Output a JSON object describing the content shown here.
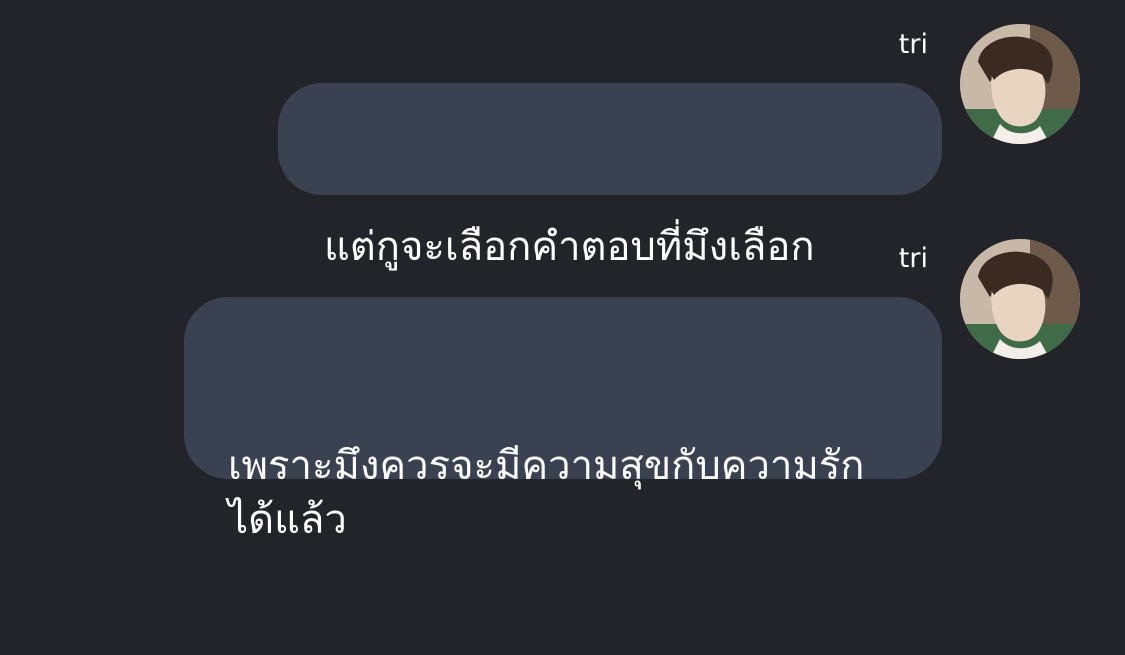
{
  "colors": {
    "background": "#23242a",
    "bubble": "#3a4151",
    "text": "#ffffff"
  },
  "messages": [
    {
      "sender": "tri",
      "text": "แต่กูจะเลือกคำตอบที่มึงเลือก",
      "avatar_icon": "profile-photo-avatar"
    },
    {
      "sender": "tri",
      "text": "เพราะมึงควรจะมีความสุขกับความรักได้แล้ว",
      "avatar_icon": "profile-photo-avatar"
    }
  ]
}
